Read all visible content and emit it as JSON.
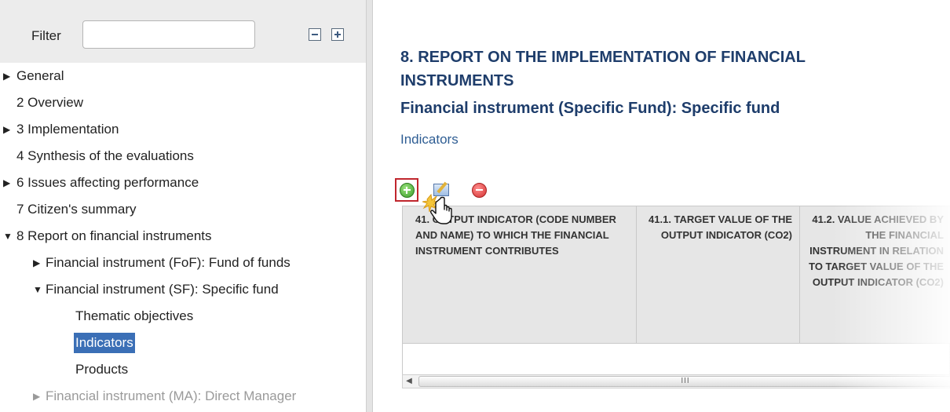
{
  "filter": {
    "label": "Filter",
    "value": "",
    "collapse_all_icon": "minus-box-icon",
    "expand_all_icon": "plus-box-icon"
  },
  "tree": {
    "items": [
      {
        "label": "General",
        "expanded": false
      },
      {
        "label": "2 Overview"
      },
      {
        "label": "3 Implementation",
        "expanded": false
      },
      {
        "label": "4 Synthesis of the evaluations"
      },
      {
        "label": "6 Issues affecting performance",
        "expanded": false
      },
      {
        "label": "7 Citizen's summary"
      },
      {
        "label": "8 Report on financial instruments",
        "expanded": true
      },
      {
        "label": "Financial instrument (FoF): Fund of funds",
        "expanded": false
      },
      {
        "label": "Financial instrument (SF): Specific fund",
        "expanded": true
      },
      {
        "label": "Thematic objectives"
      },
      {
        "label": "Indicators",
        "selected": true
      },
      {
        "label": "Products"
      },
      {
        "label": "Financial instrument (MA): Direct Manager",
        "expanded": false
      }
    ],
    "arrow_collapsed": "▶",
    "arrow_expanded": "▼"
  },
  "main": {
    "section_title": "8. REPORT ON THE IMPLEMENTATION OF FINANCIAL INSTRUMENTS",
    "instrument_title": "Financial instrument (Specific Fund): Specific fund",
    "subsection": "Indicators",
    "toolbar": {
      "add_icon": "add-circle-icon",
      "edit_icon": "edit-icon",
      "remove_icon": "remove-circle-icon"
    },
    "table": {
      "columns": [
        "41. OUTPUT INDICATOR (CODE NUMBER AND NAME) TO WHICH THE FINANCIAL INSTRUMENT CONTRIBUTES",
        "41.1. TARGET VALUE OF THE OUTPUT INDICATOR (CO2)",
        "41.2. VALUE ACHIEVED BY THE FINANCIAL INSTRUMENT IN RELATION TO TARGET VALUE OF THE OUTPUT INDICATOR (CO2)"
      ],
      "rows": []
    },
    "scrollbar": {
      "left_arrow": "◀",
      "grip": "III"
    }
  },
  "colors": {
    "title": "#1e3d6b",
    "link": "#2e5d93",
    "selected_bg": "#3b6fb6",
    "highlight_border": "#c0262d"
  }
}
